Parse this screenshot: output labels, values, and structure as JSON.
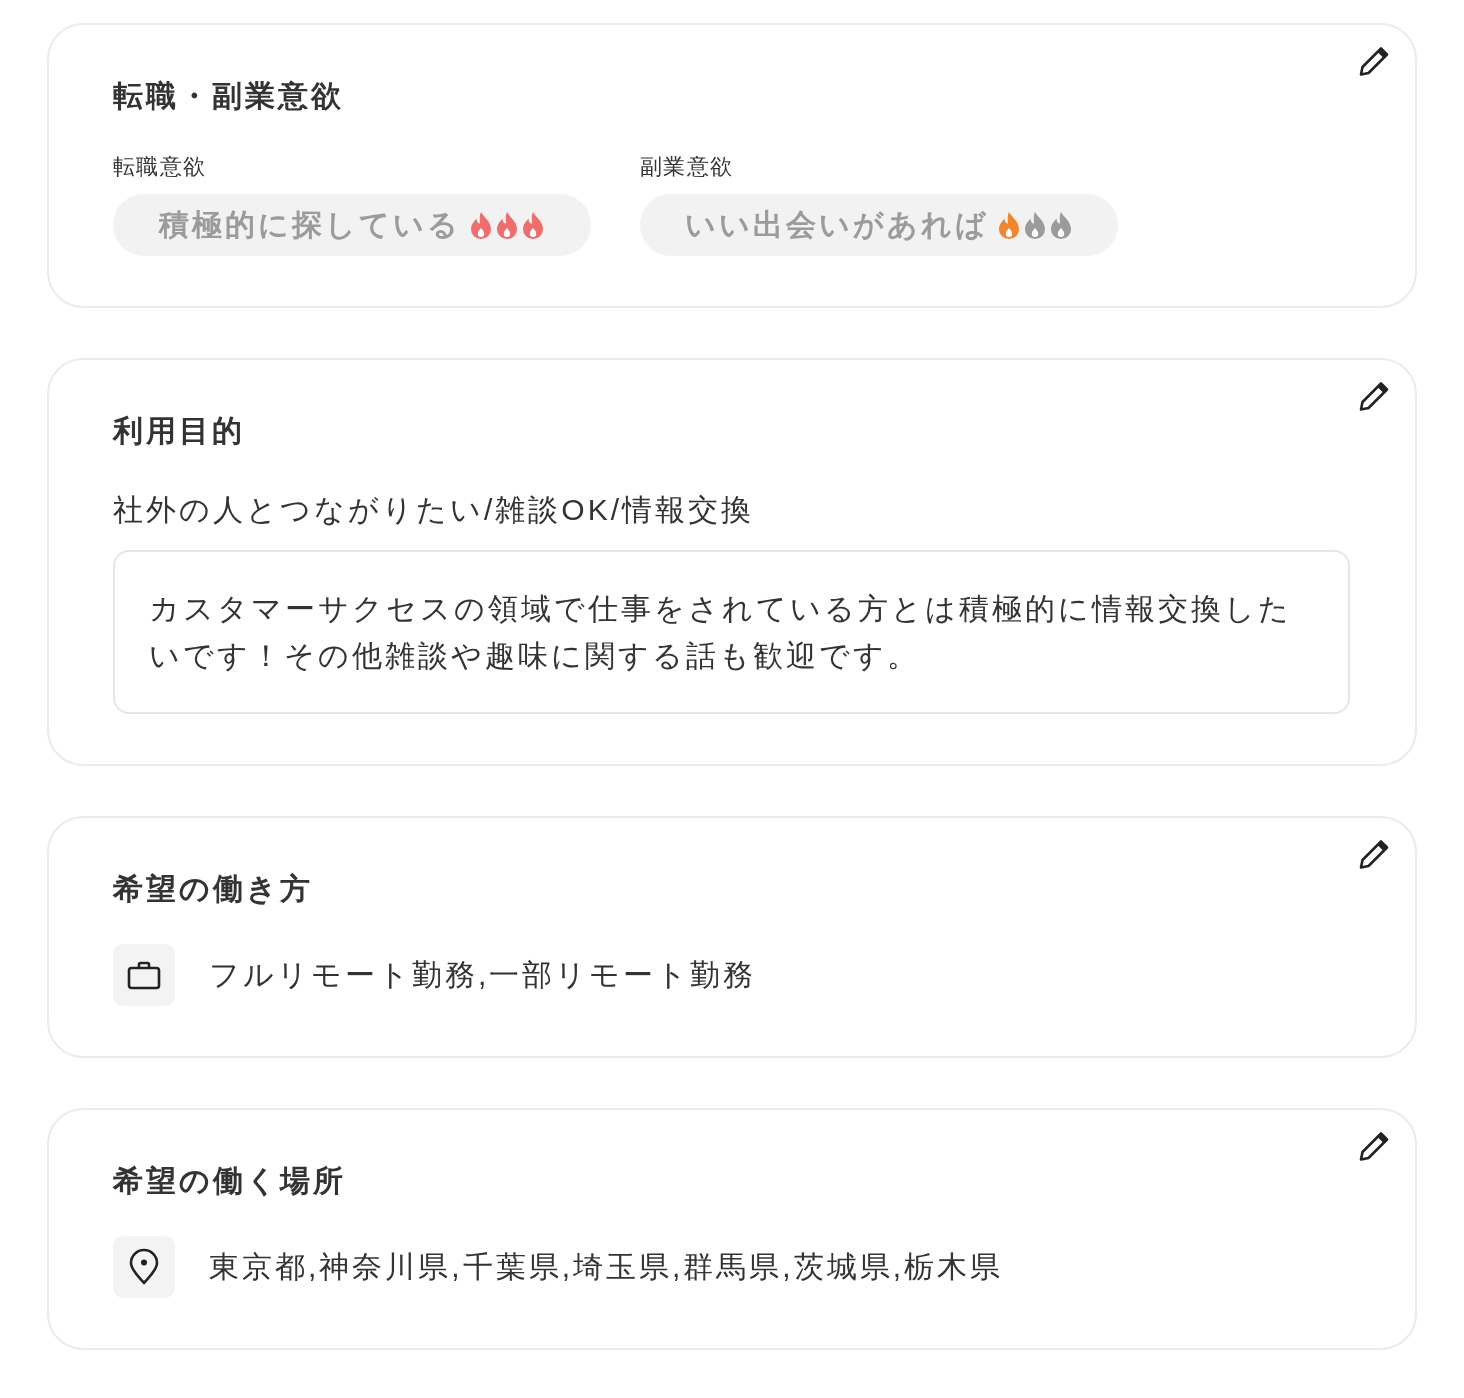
{
  "cards": [
    {
      "kind": "motivation",
      "title": "転職・副業意欲",
      "items": [
        {
          "label": "転職意欲",
          "value": "積極的に探している",
          "stars": 3,
          "color": "#ee6e6e"
        },
        {
          "label": "副業意欲",
          "value": "いい出会いがあれば",
          "stars": 1,
          "color": "#f0872e"
        }
      ]
    },
    {
      "kind": "purpose",
      "title": "利用目的",
      "summary": "社外の人とつながりたい/雑談OK/情報交換",
      "description": "カスタマーサクセスの領域で仕事をされている方とは積極的に情報交換したいです！その他雑談や趣味に関する話も歓迎です。"
    },
    {
      "kind": "work_style",
      "title": "希望の働き方",
      "value": "フルリモート勤務,一部リモート勤務"
    },
    {
      "kind": "work_location",
      "title": "希望の働く場所",
      "value": "東京都,神奈川県,千葉県,埼玉県,群馬県,茨城県,栃木県"
    }
  ]
}
